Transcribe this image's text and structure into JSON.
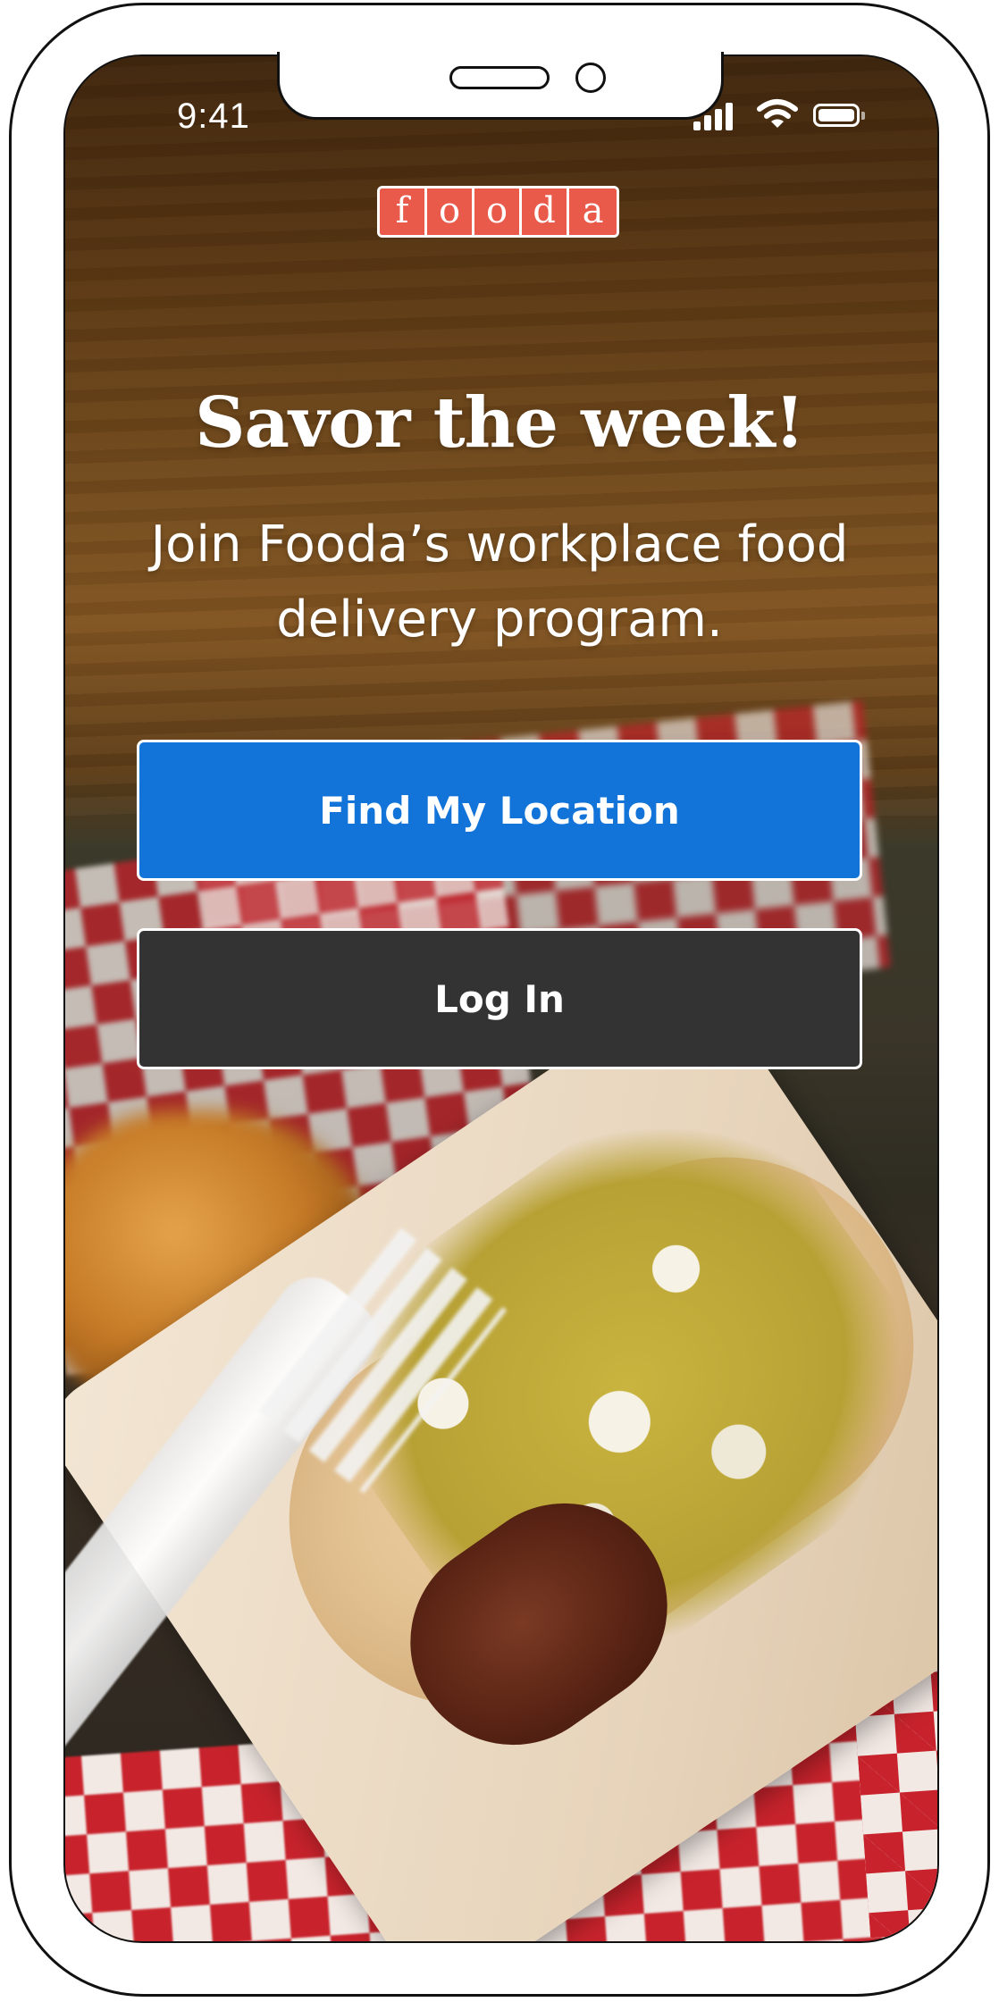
{
  "status_bar": {
    "time": "9:41",
    "icons": [
      "signal-icon",
      "wifi-icon",
      "battery-icon"
    ]
  },
  "logo": {
    "letters": [
      "f",
      "o",
      "o",
      "d",
      "a"
    ],
    "color": "#ea5a4a"
  },
  "hero": {
    "headline": "Savor the week!",
    "subheadline": "Join Fooda’s workplace food delivery program."
  },
  "actions": {
    "find_location_label": "Find My Location",
    "login_label": "Log In"
  },
  "colors": {
    "primary_button": "#1273d9",
    "secondary_button": "#333333",
    "text": "#ffffff"
  }
}
